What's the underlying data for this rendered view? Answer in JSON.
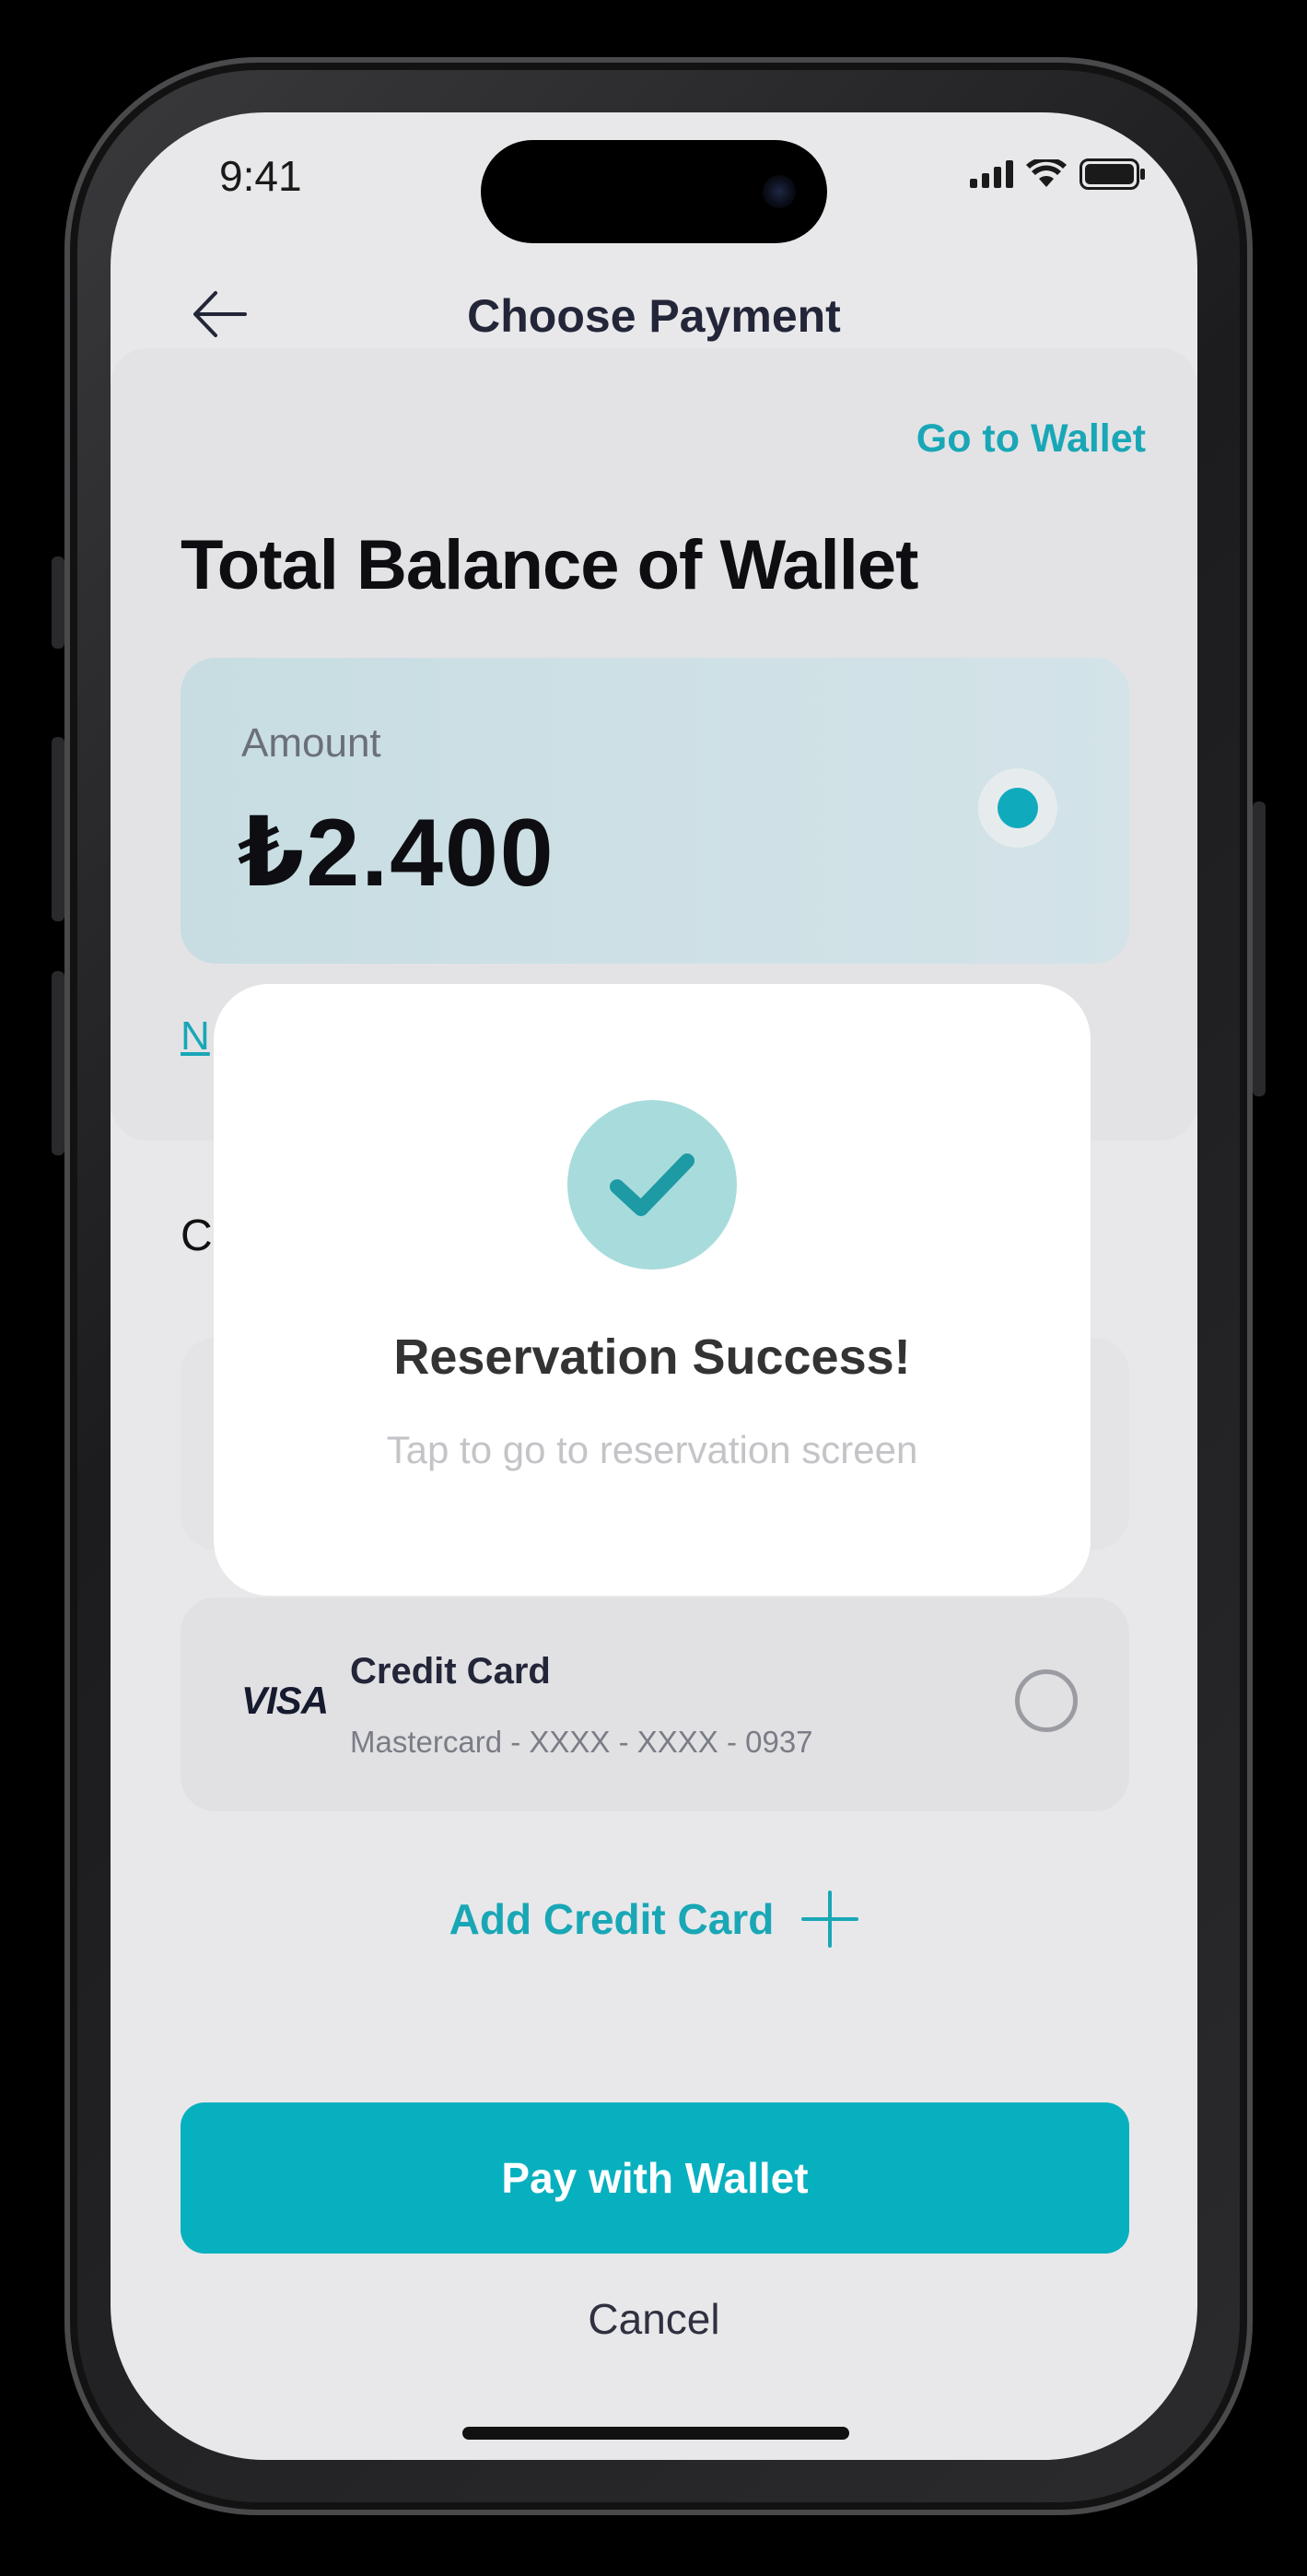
{
  "status_bar": {
    "time": "9:41"
  },
  "header": {
    "title": "Choose Payment",
    "back_icon": "back-arrow-icon"
  },
  "wallet": {
    "go_to_wallet_label": "Go to Wallet",
    "total_title": "Total Balance of Wallet",
    "amount_label": "Amount",
    "amount_value": "₺2.400",
    "partial_link_text": "N",
    "partial_section_text": "C"
  },
  "credit_card": {
    "brand": "VISA",
    "title": "Credit Card",
    "number": "Mastercard - XXXX - XXXX  - 0937"
  },
  "actions": {
    "add_credit_card_label": "Add Credit Card",
    "pay_button_label": "Pay with Wallet",
    "cancel_label": "Cancel"
  },
  "modal": {
    "title": "Reservation Success!",
    "subtitle": "Tap to go to reservation screen",
    "icon": "checkmark-icon"
  },
  "colors": {
    "accent": "#07b0bf",
    "link": "#19a7b6",
    "success_circle": "#a8dcdc",
    "background": "#e8e8ea"
  }
}
